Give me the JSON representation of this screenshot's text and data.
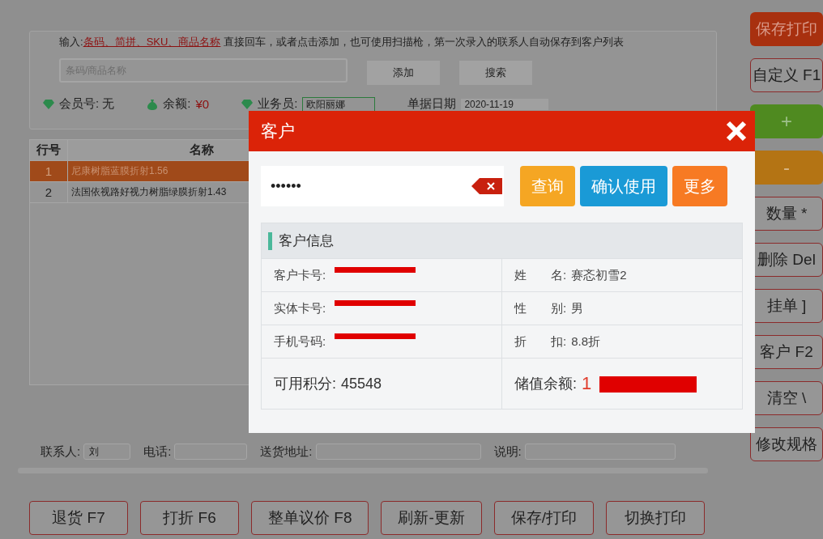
{
  "entry": {
    "hint_prefix": "输入:",
    "hint_link": "条码、简拼、SKU、商品名称",
    "hint_rest": "直接回车，或者点击添加，也可使用扫描枪，第一次录入的联系人自动保存到客户列表",
    "placeholder": "条码/商品名称",
    "buttons": [
      "添加",
      "搜索"
    ]
  },
  "info_bar": [
    {
      "kind": "member",
      "label": "会员号: 无"
    },
    {
      "kind": "balance",
      "label": "余额:",
      "value": "¥0"
    },
    {
      "kind": "select",
      "label": "业务员:",
      "value": "欧阳丽娜"
    },
    {
      "kind": "date",
      "label": "单据日期",
      "value": "2020-11-19"
    }
  ],
  "table": {
    "columns": [
      "行号",
      "名称"
    ],
    "rows": [
      {
        "cells": [
          "1",
          "尼康树脂蓝膜折射1.56"
        ],
        "selected": true
      },
      {
        "cells": [
          "2",
          "法国依视路好视力树脂绿膜折射1.43"
        ],
        "selected": false
      }
    ]
  },
  "contact": [
    {
      "label": "联系人:",
      "value": "刘"
    },
    {
      "label": "电话:"
    },
    {
      "label": "送货地址:"
    },
    {
      "label": "说明:"
    }
  ],
  "bottom_buttons": [
    "退货 F7",
    "打折 F6",
    "整单议价 F8",
    "刷新-更新",
    "保存/打印",
    "切换打印"
  ],
  "side_buttons": [
    {
      "label": "保存打印",
      "kind": "danger"
    },
    {
      "label": "自定义 F1",
      "kind": "plain"
    },
    {
      "label": "+",
      "kind": "add"
    },
    {
      "label": "-",
      "kind": "minus"
    },
    {
      "label": "数量 *",
      "kind": "plain"
    },
    {
      "label": "删除 Del",
      "kind": "plain"
    },
    {
      "label": "挂单 ]",
      "kind": "plain"
    },
    {
      "label": "客户 F2",
      "kind": "plain"
    },
    {
      "label": "清空 \\",
      "kind": "plain"
    },
    {
      "label": "修改规格",
      "kind": "plain"
    }
  ],
  "dialog": {
    "title": "客户",
    "search_value": "••••••",
    "buttons": [
      {
        "label": "查询",
        "color": "#f5a623"
      },
      {
        "label": "确认使用",
        "color": "#1a9ad6"
      },
      {
        "label": "更多",
        "color": "#f77a23"
      }
    ],
    "section_title": "客户信息",
    "fields": [
      [
        {
          "label": "客户卡号:",
          "redacted": true
        },
        {
          "label": "姓　　名:",
          "value": "赛忞初雪2"
        }
      ],
      [
        {
          "label": "实体卡号:",
          "redacted": true
        },
        {
          "label": "性　　别:",
          "value": "男"
        }
      ],
      [
        {
          "label": "手机号码:",
          "redacted": true
        },
        {
          "label": "折　　扣:",
          "value": "8.8折"
        }
      ]
    ],
    "summary": [
      {
        "label": "可用积分:",
        "value": "45548"
      },
      {
        "label": "储值余额:",
        "value": "1",
        "redacted": true
      }
    ]
  }
}
